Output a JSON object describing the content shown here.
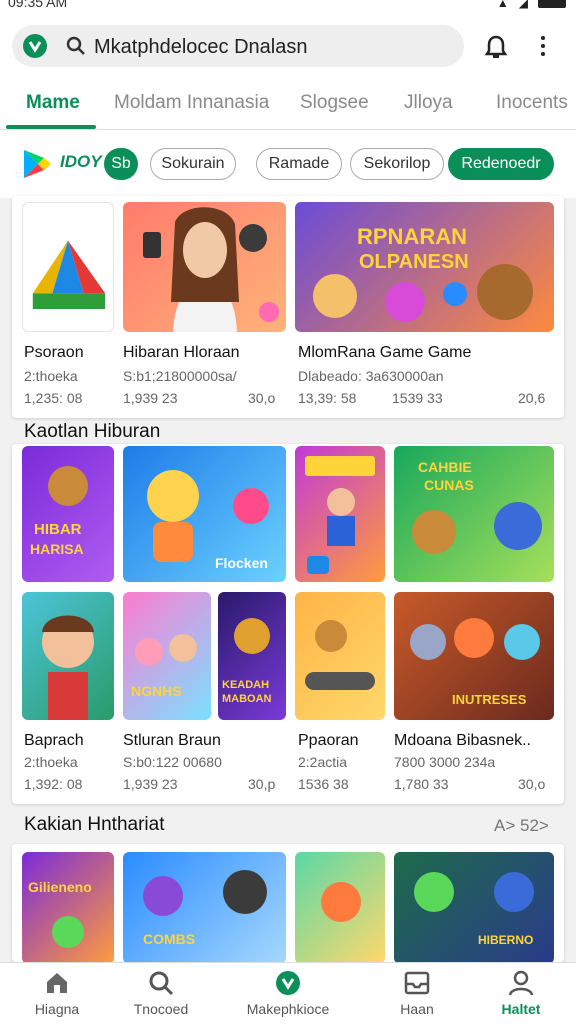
{
  "status": {
    "time": "09:35 AM"
  },
  "search": {
    "text": "Mkatphdelocec Dnalasn"
  },
  "tabs": [
    "Mame",
    "Moldam Innanasia",
    "Slogsee",
    "Jlloya",
    "Inocents"
  ],
  "chips": {
    "brand": "IDOY",
    "badge": "Sb",
    "items": [
      "Sokurain",
      "Ramade",
      "Sekorilop",
      "Redenoedr"
    ]
  },
  "top_apps": [
    {
      "title": "Psoraon",
      "sub": "2:thoeka",
      "rating": "1,235: 08",
      "size": ""
    },
    {
      "title": "Hibaran Hloraan",
      "sub": "S:b1;21800000sa/",
      "rating": "1,939 23",
      "size": "30,o"
    },
    {
      "title": "MlomRana Game Game",
      "sub": "Dlabeado: 3a630000an",
      "rating": "13,39: 58",
      "size": "20,6",
      "rating2": "1539 33"
    }
  ],
  "section2": {
    "title": "Kaotlan Hiburan",
    "tile_texts": [
      "HIBAR HARISA",
      "Flocken",
      "",
      "CAHBIE CUNAS"
    ],
    "apps": [
      {
        "title": "Baprach",
        "sub": "2:thoeka",
        "rating": "1,392: 08",
        "size": ""
      },
      {
        "title": "Stluran Braun",
        "sub": "S:b0:122 00680",
        "rating": "1,939 23",
        "size": "30,p"
      },
      {
        "title": "Ppaoran",
        "sub": "2:2actia",
        "rating": "1536 38",
        "size": ""
      },
      {
        "title": "Mdoana Bibasnek..",
        "sub": "7800 3000 234a",
        "rating": "1,780 33",
        "size": "30,o"
      }
    ],
    "row2_texts": [
      "",
      "NGNHS",
      "KEADAH MABOAN",
      "",
      "INUTRESES"
    ]
  },
  "section3": {
    "title": "Kakian Hnthariat",
    "more": "A> 52>",
    "tile_texts": [
      "Gilieneno",
      "COMBS",
      "",
      "HIBERNO"
    ]
  },
  "bottom_nav": [
    "Hiagna",
    "Tnocoed",
    "Makephkioce",
    "Haan",
    "Haltet"
  ],
  "colors": {
    "accent": "#0a8f5a"
  }
}
